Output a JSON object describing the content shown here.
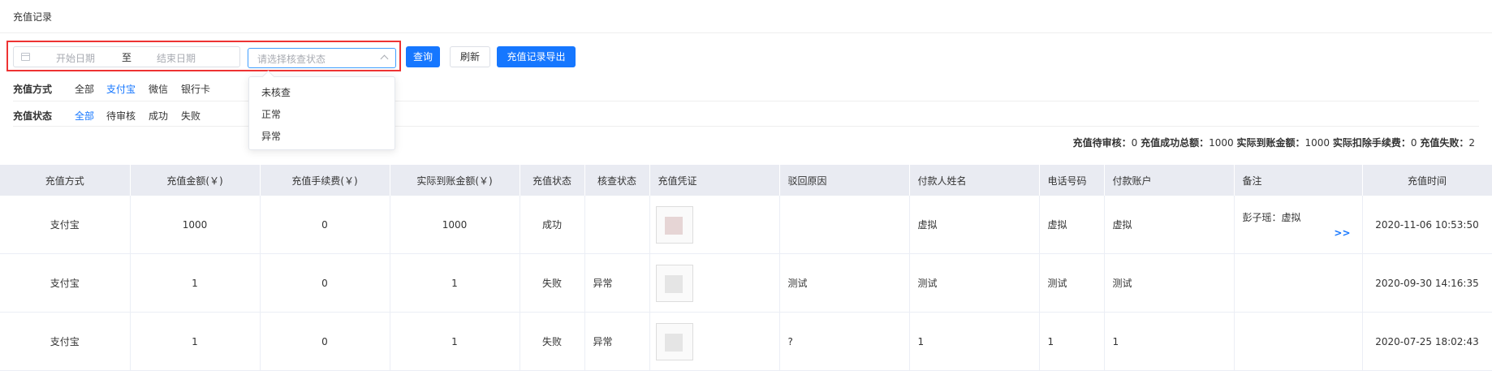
{
  "page_title": "充值记录",
  "filters": {
    "start_placeholder": "开始日期",
    "range_separator": "至",
    "end_placeholder": "结束日期",
    "status_placeholder": "请选择核查状态",
    "status_options": [
      "未核查",
      "正常",
      "异常"
    ],
    "query_label": "查询",
    "refresh_label": "刷新",
    "export_label": "充值记录导出",
    "method_label": "充值方式",
    "method_options": [
      {
        "label": "全部",
        "active": false
      },
      {
        "label": "支付宝",
        "active": true
      },
      {
        "label": "微信",
        "active": false
      },
      {
        "label": "银行卡",
        "active": false
      }
    ],
    "state_label": "充值状态",
    "state_options": [
      {
        "label": "全部",
        "active": true
      },
      {
        "label": "待审核",
        "active": false
      },
      {
        "label": "成功",
        "active": false
      },
      {
        "label": "失败",
        "active": false
      }
    ]
  },
  "summary": {
    "pending_label": "充值待审核：",
    "pending_value": "0",
    "success_total_label": "充值成功总额：",
    "success_total_value": "1000",
    "received_label": "实际到账金额：",
    "received_value": "1000",
    "fee_label": "实际扣除手续费：",
    "fee_value": "0",
    "failed_label": "充值失败：",
    "failed_value": "2"
  },
  "table": {
    "columns": [
      "充值方式",
      "充值金额(￥)",
      "充值手续费(￥)",
      "实际到账金额(￥)",
      "充值状态",
      "核查状态",
      "充值凭证",
      "驳回原因",
      "付款人姓名",
      "电话号码",
      "付款账户",
      "备注",
      "充值时间"
    ],
    "rows": [
      {
        "method": "支付宝",
        "amount": "1000",
        "fee": "0",
        "received": "1000",
        "status": "成功",
        "check": "",
        "reason": "",
        "payer": "虚拟",
        "phone": "虚拟",
        "account": "虚拟",
        "remark": "彭子瑶：虚拟",
        "more": ">>",
        "time": "2020-11-06 10:53:50"
      },
      {
        "method": "支付宝",
        "amount": "1",
        "fee": "0",
        "received": "1",
        "status": "失败",
        "check": "异常",
        "reason": "测试",
        "payer": "测试",
        "phone": "测试",
        "account": "测试",
        "remark": "",
        "more": "",
        "time": "2020-09-30 14:16:35"
      },
      {
        "method": "支付宝",
        "amount": "1",
        "fee": "0",
        "received": "1",
        "status": "失败",
        "check": "异常",
        "reason": "?",
        "payer": "1",
        "phone": "1",
        "account": "1",
        "remark": "",
        "more": "",
        "time": "2020-07-25 18:02:43"
      }
    ]
  },
  "colors": {
    "accent": "#1677ff",
    "error": "#f5222d",
    "highlight_border": "#e33333",
    "header_bg": "#e9ebf2"
  }
}
